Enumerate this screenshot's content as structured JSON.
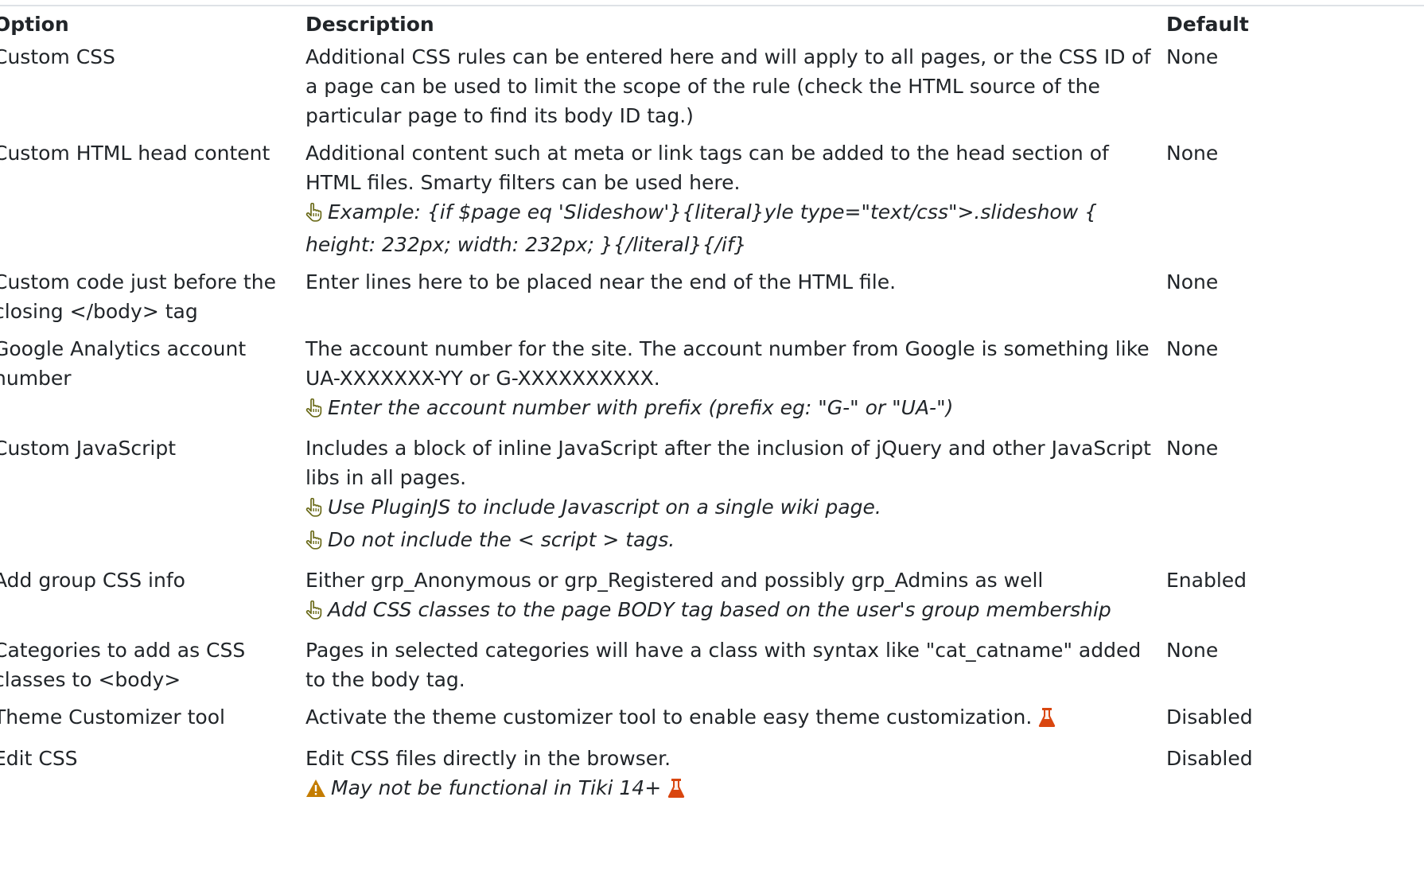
{
  "headers": {
    "option": "Option",
    "description": "Description",
    "default": "Default"
  },
  "colors": {
    "hand_icon": "#6b6b1a",
    "beaker_icon": "#d9460f",
    "warning_icon": "#c47c00",
    "rule": "#dee2e6"
  },
  "rows": [
    {
      "option": "Custom CSS",
      "description": "Additional CSS rules can be entered here and will apply to all pages, or the CSS ID of a page can be used to limit the scope of the rule (check the HTML source of the particular page to find its body ID tag.)",
      "default": "None"
    },
    {
      "option": "Custom HTML head content",
      "description": "Additional content such at meta or link tags can be added to the head section of HTML files. Smarty filters can be used here.",
      "notes": [
        "Example: {if $page eq 'Slideshow'}{literal}yle type=\"text/css\">.slideshow { height: 232px; width: 232px; }{/literal}{/if}"
      ],
      "default": "None"
    },
    {
      "option": "Custom code just before the closing </body> tag",
      "description": "Enter lines here to be placed near the end of the HTML file.",
      "default": "None"
    },
    {
      "option": "Google Analytics account number",
      "description": "The account number for the site. The account number from Google is something like UA-XXXXXXX-YY or G-XXXXXXXXXX.",
      "notes": [
        "Enter the account number with prefix (prefix eg: \"G-\" or \"UA-\")"
      ],
      "default": "None"
    },
    {
      "option": "Custom JavaScript",
      "description": "Includes a block of inline JavaScript after the inclusion of jQuery and other JavaScript libs in all pages.",
      "notes": [
        "Use PluginJS to include Javascript on a single wiki page.",
        "Do not include the < script > tags."
      ],
      "default": "None"
    },
    {
      "option": "Add group CSS info",
      "description": "Either grp_Anonymous or grp_Registered and possibly grp_Admins as well",
      "notes": [
        "Add CSS classes to the page BODY tag based on the user's group membership"
      ],
      "default": "Enabled"
    },
    {
      "option": "Categories to add as CSS classes to <body>",
      "description": "Pages in selected categories will have a class with syntax like \"cat_catname\" added to the body tag.",
      "default": "None"
    },
    {
      "option": "Theme Customizer tool",
      "description": "Activate the theme customizer tool to enable easy theme customization.",
      "experimental": true,
      "default": "Disabled"
    },
    {
      "option": "Edit CSS",
      "description": "Edit CSS files directly in the browser.",
      "warning": "May not be functional in Tiki 14+",
      "warning_experimental": true,
      "default": "Disabled"
    }
  ]
}
